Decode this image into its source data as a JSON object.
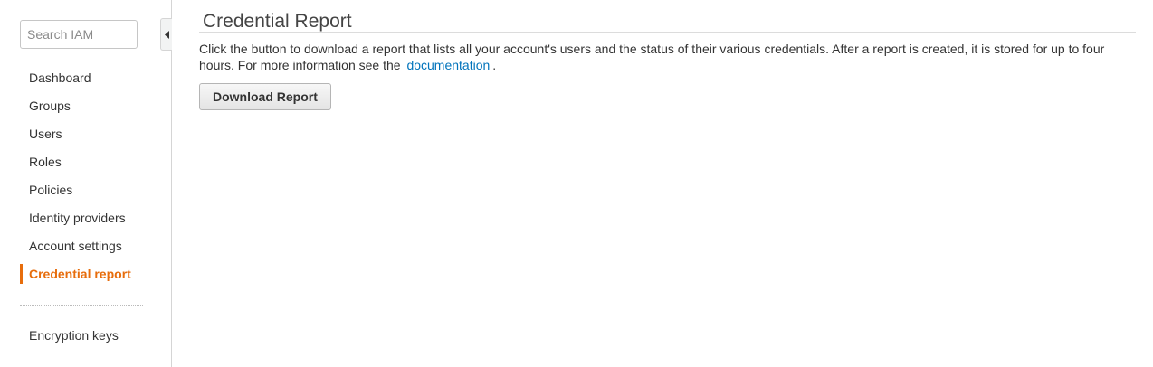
{
  "sidebar": {
    "search_placeholder": "Search IAM",
    "items": [
      {
        "label": "Dashboard"
      },
      {
        "label": "Groups"
      },
      {
        "label": "Users"
      },
      {
        "label": "Roles"
      },
      {
        "label": "Policies"
      },
      {
        "label": "Identity providers"
      },
      {
        "label": "Account settings"
      },
      {
        "label": "Credential report",
        "active": true
      }
    ],
    "secondary_items": [
      {
        "label": "Encryption keys"
      }
    ],
    "collapse_icon": "caret-left-icon"
  },
  "main": {
    "title": "Credential Report",
    "description_text": "Click the button to download a report that lists all your account's users and the status of their various credentials. After a report is created, it is stored for up to four hours. For more information see the",
    "description_link": "documentation",
    "description_end": ".",
    "download_button": "Download Report"
  },
  "colors": {
    "accent": "#e76d0c",
    "link": "#0073bb"
  }
}
